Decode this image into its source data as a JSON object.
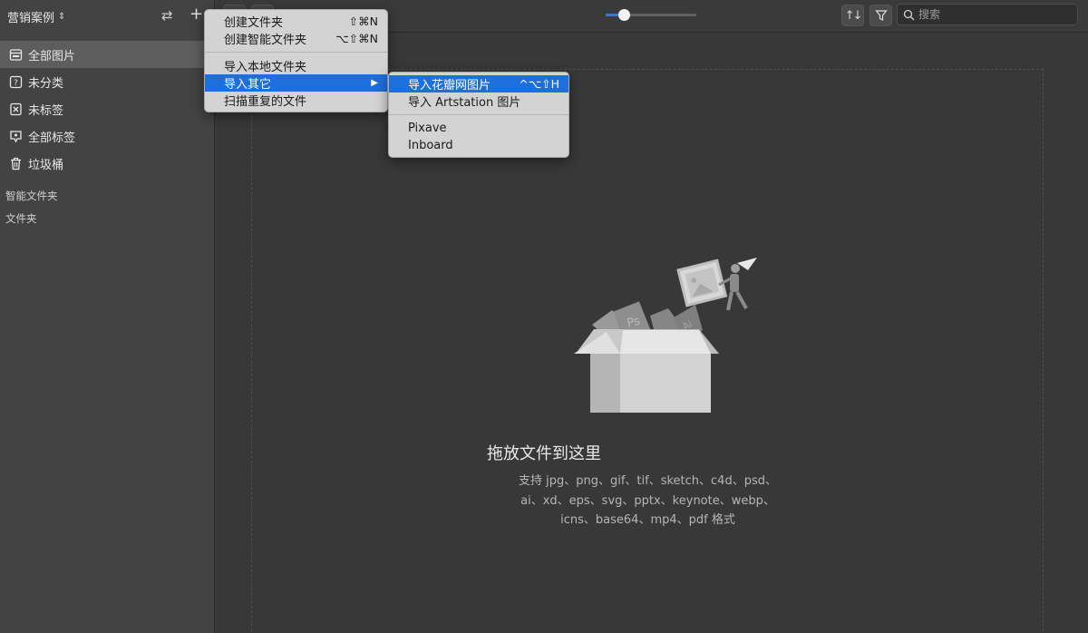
{
  "sidebar": {
    "library_name": "营销案例",
    "library_switch_icon": "⌃",
    "items": [
      {
        "label": "全部图片",
        "icon": "all-images-icon",
        "active": true
      },
      {
        "label": "未分类",
        "icon": "uncategorized-icon",
        "active": false
      },
      {
        "label": "未标签",
        "icon": "untagged-icon",
        "active": false
      },
      {
        "label": "全部标签",
        "icon": "all-tags-icon",
        "active": false
      },
      {
        "label": "垃圾桶",
        "icon": "trash-icon",
        "active": false
      }
    ],
    "sections": {
      "smart_folders": "智能文件夹",
      "folders": "文件夹"
    }
  },
  "toolbar": {
    "search_placeholder": "搜索",
    "zoom_fraction": 0.2
  },
  "menu": {
    "items": [
      {
        "label": "创建文件夹",
        "shortcut": "⇧⌘N"
      },
      {
        "label": "创建智能文件夹",
        "shortcut": "⌥⇧⌘N"
      },
      {
        "label": "导入本地文件夹",
        "shortcut": ""
      },
      {
        "label": "导入其它",
        "shortcut": "▶"
      },
      {
        "label": "扫描重复的文件",
        "shortcut": ""
      }
    ]
  },
  "submenu": {
    "items": [
      {
        "label": "导入花瓣网图片",
        "shortcut": "^⌥⇧H"
      },
      {
        "label": "导入 Artstation 图片",
        "shortcut": ""
      },
      {
        "label": "Pixave",
        "shortcut": ""
      },
      {
        "label": "Inboard",
        "shortcut": ""
      }
    ]
  },
  "empty_state": {
    "title": "拖放文件到这里",
    "line1": "支持 jpg、png、gif、tif、sketch、c4d、psd、",
    "line2": "ai、xd、eps、svg、pptx、keynote、webp、",
    "line3": "icns、base64、mp4、pdf 格式"
  },
  "colors": {
    "accent": "#1c6fdc",
    "slider": "#3a78d6"
  }
}
